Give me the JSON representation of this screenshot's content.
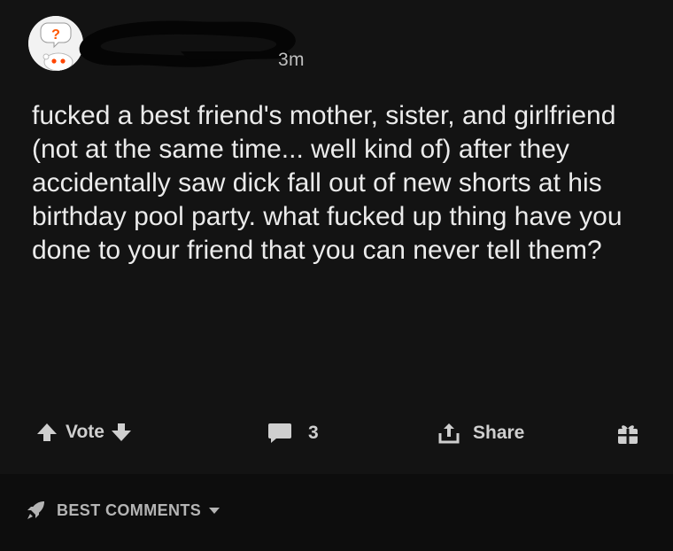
{
  "post": {
    "timestamp": "3m",
    "title": "fucked a best friend's mother, sister, and girlfriend (not at the same time... well kind of) after they accidentally saw dick fall out of new shorts at his birthday pool party. what fucked up thing have you done to your friend that you can never tell them?"
  },
  "actions": {
    "vote_label": "Vote",
    "comment_count": "3",
    "share_label": "Share"
  },
  "comments_section": {
    "sort_label": "BEST COMMENTS"
  },
  "colors": {
    "background": "#131313",
    "bottom_bar": "#0d0d0d",
    "text": "#ebebeb",
    "muted": "#cfcfcf"
  },
  "icons": [
    "avatar-snoo-icon",
    "upvote-icon",
    "downvote-icon",
    "comment-icon",
    "share-icon",
    "award-icon",
    "rocket-icon",
    "caret-down-icon"
  ]
}
